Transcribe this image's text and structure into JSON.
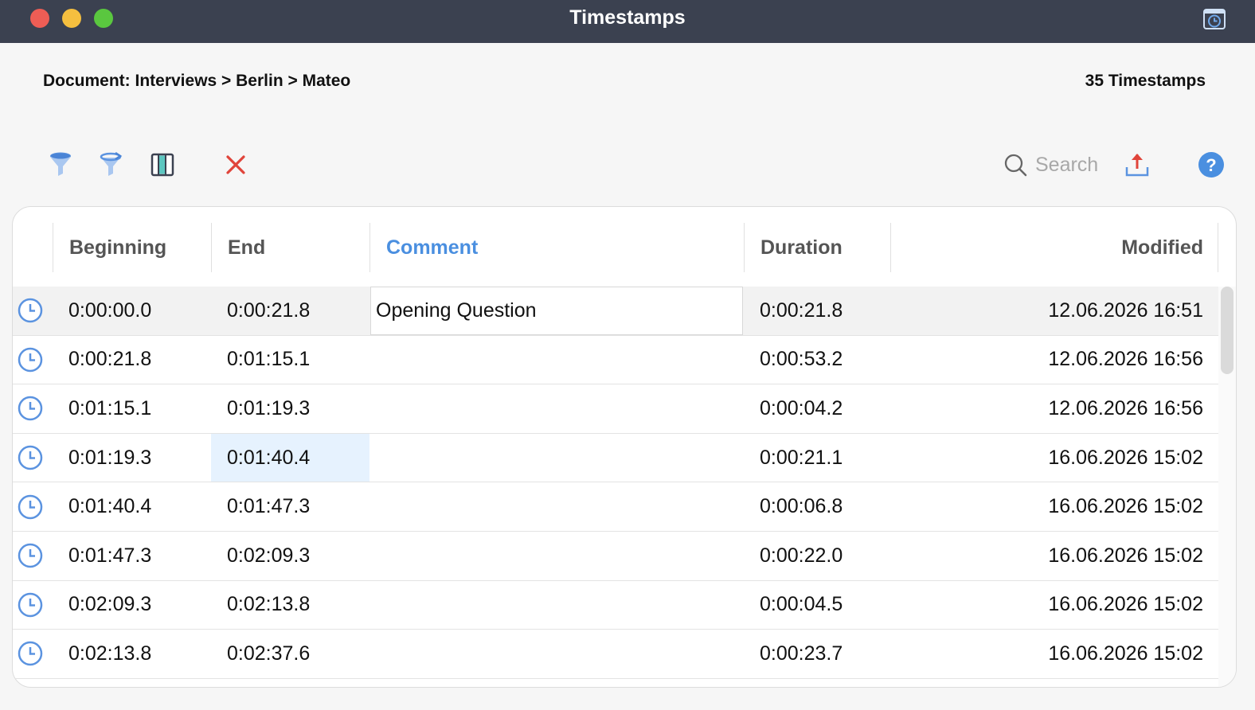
{
  "window": {
    "title": "Timestamps",
    "icon": "clock-window-icon"
  },
  "header": {
    "document_path": "Document: Interviews > Berlin > Mateo",
    "count_label": "35 Timestamps"
  },
  "toolbar": {
    "filter_icon": "filter-icon",
    "reset_filter_icon": "reset-filter-icon",
    "columns_icon": "columns-icon",
    "delete_icon": "delete-icon",
    "search_placeholder": "Search",
    "export_icon": "export-icon",
    "help_icon": "help-icon"
  },
  "colors": {
    "accent": "#4a8fe0",
    "titlebar": "#3b4150",
    "delete": "#e0443a",
    "highlight": "#e6f2fe"
  },
  "table": {
    "columns": {
      "beginning": "Beginning",
      "end": "End",
      "comment": "Comment",
      "duration": "Duration",
      "modified": "Modified"
    },
    "sorted_column": "comment",
    "rows": [
      {
        "beginning": "0:00:00.0",
        "end": "0:00:21.8",
        "comment": "Opening Question",
        "duration": "0:00:21.8",
        "modified": "12.06.2026 16:51"
      },
      {
        "beginning": "0:00:21.8",
        "end": "0:01:15.1",
        "comment": "",
        "duration": "0:00:53.2",
        "modified": "12.06.2026 16:56"
      },
      {
        "beginning": "0:01:15.1",
        "end": "0:01:19.3",
        "comment": "",
        "duration": "0:00:04.2",
        "modified": "12.06.2026 16:56"
      },
      {
        "beginning": "0:01:19.3",
        "end": "0:01:40.4",
        "comment": "",
        "duration": "0:00:21.1",
        "modified": "16.06.2026 15:02"
      },
      {
        "beginning": "0:01:40.4",
        "end": "0:01:47.3",
        "comment": "",
        "duration": "0:00:06.8",
        "modified": "16.06.2026 15:02"
      },
      {
        "beginning": "0:01:47.3",
        "end": "0:02:09.3",
        "comment": "",
        "duration": "0:00:22.0",
        "modified": "16.06.2026 15:02"
      },
      {
        "beginning": "0:02:09.3",
        "end": "0:02:13.8",
        "comment": "",
        "duration": "0:00:04.5",
        "modified": "16.06.2026 15:02"
      },
      {
        "beginning": "0:02:13.8",
        "end": "0:02:37.6",
        "comment": "",
        "duration": "0:00:23.7",
        "modified": "16.06.2026 15:02"
      }
    ]
  }
}
